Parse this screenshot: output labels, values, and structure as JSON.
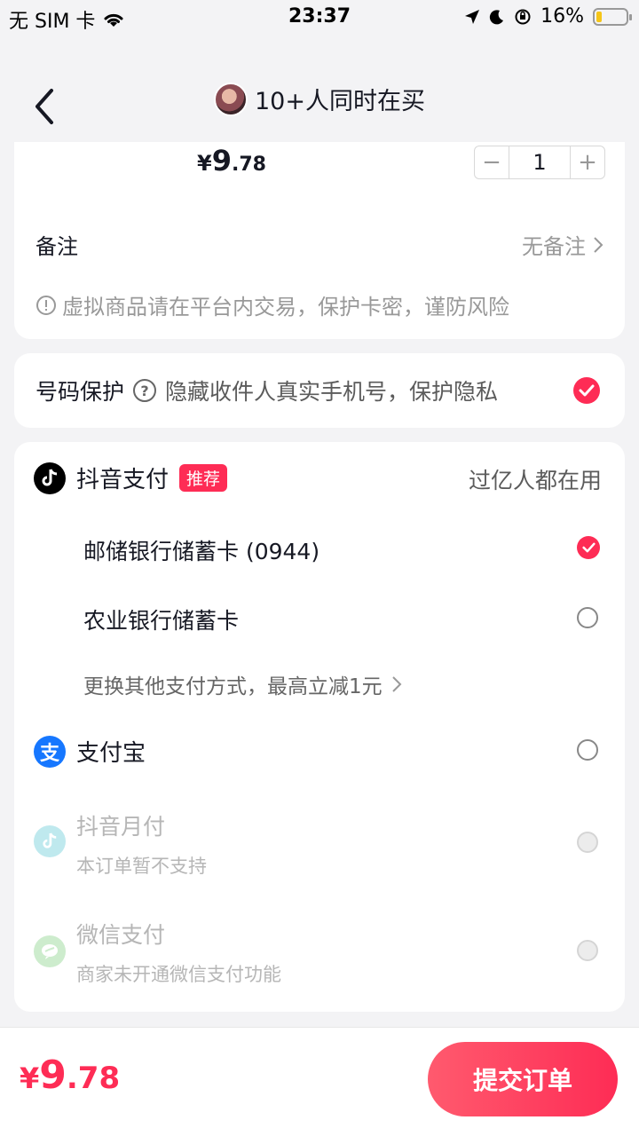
{
  "status_bar": {
    "carrier": "无 SIM 卡",
    "time": "23:37",
    "battery": "16%",
    "battery_level": 0.16
  },
  "nav": {
    "title": "10+人同时在买"
  },
  "item": {
    "price_symbol": "¥",
    "price_int": "9",
    "price_dec": ".78",
    "quantity": "1",
    "minus": "−",
    "plus": "+"
  },
  "remark": {
    "label": "备注",
    "value": "无备注",
    "warning": "虚拟商品请在平台内交易，保护卡密，谨防风险"
  },
  "privacy": {
    "label": "号码保护",
    "desc": "隐藏收件人真实手机号，保护隐私",
    "checked": true
  },
  "payment": {
    "douyin": {
      "label": "抖音支付",
      "tag": "推荐",
      "slogan": "过亿人都在用",
      "banks": [
        {
          "label": "邮储银行储蓄卡 (0944)",
          "selected": true
        },
        {
          "label": "农业银行储蓄卡",
          "selected": false
        }
      ],
      "more": "更换其他支付方式，最高立减1元"
    },
    "alipay": {
      "label": "支付宝",
      "icon_text": "支"
    },
    "monthly": {
      "label": "抖音月付",
      "note": "本订单暂不支持"
    },
    "wechat": {
      "label": "微信支付",
      "note": "商家未开通微信支付功能"
    }
  },
  "footer": {
    "total_symbol": "¥",
    "total_int": "9",
    "total_dec": ".78",
    "submit_label": "提交订单"
  },
  "colors": {
    "accent": "#fe2c55",
    "alipay": "#1677ff"
  }
}
